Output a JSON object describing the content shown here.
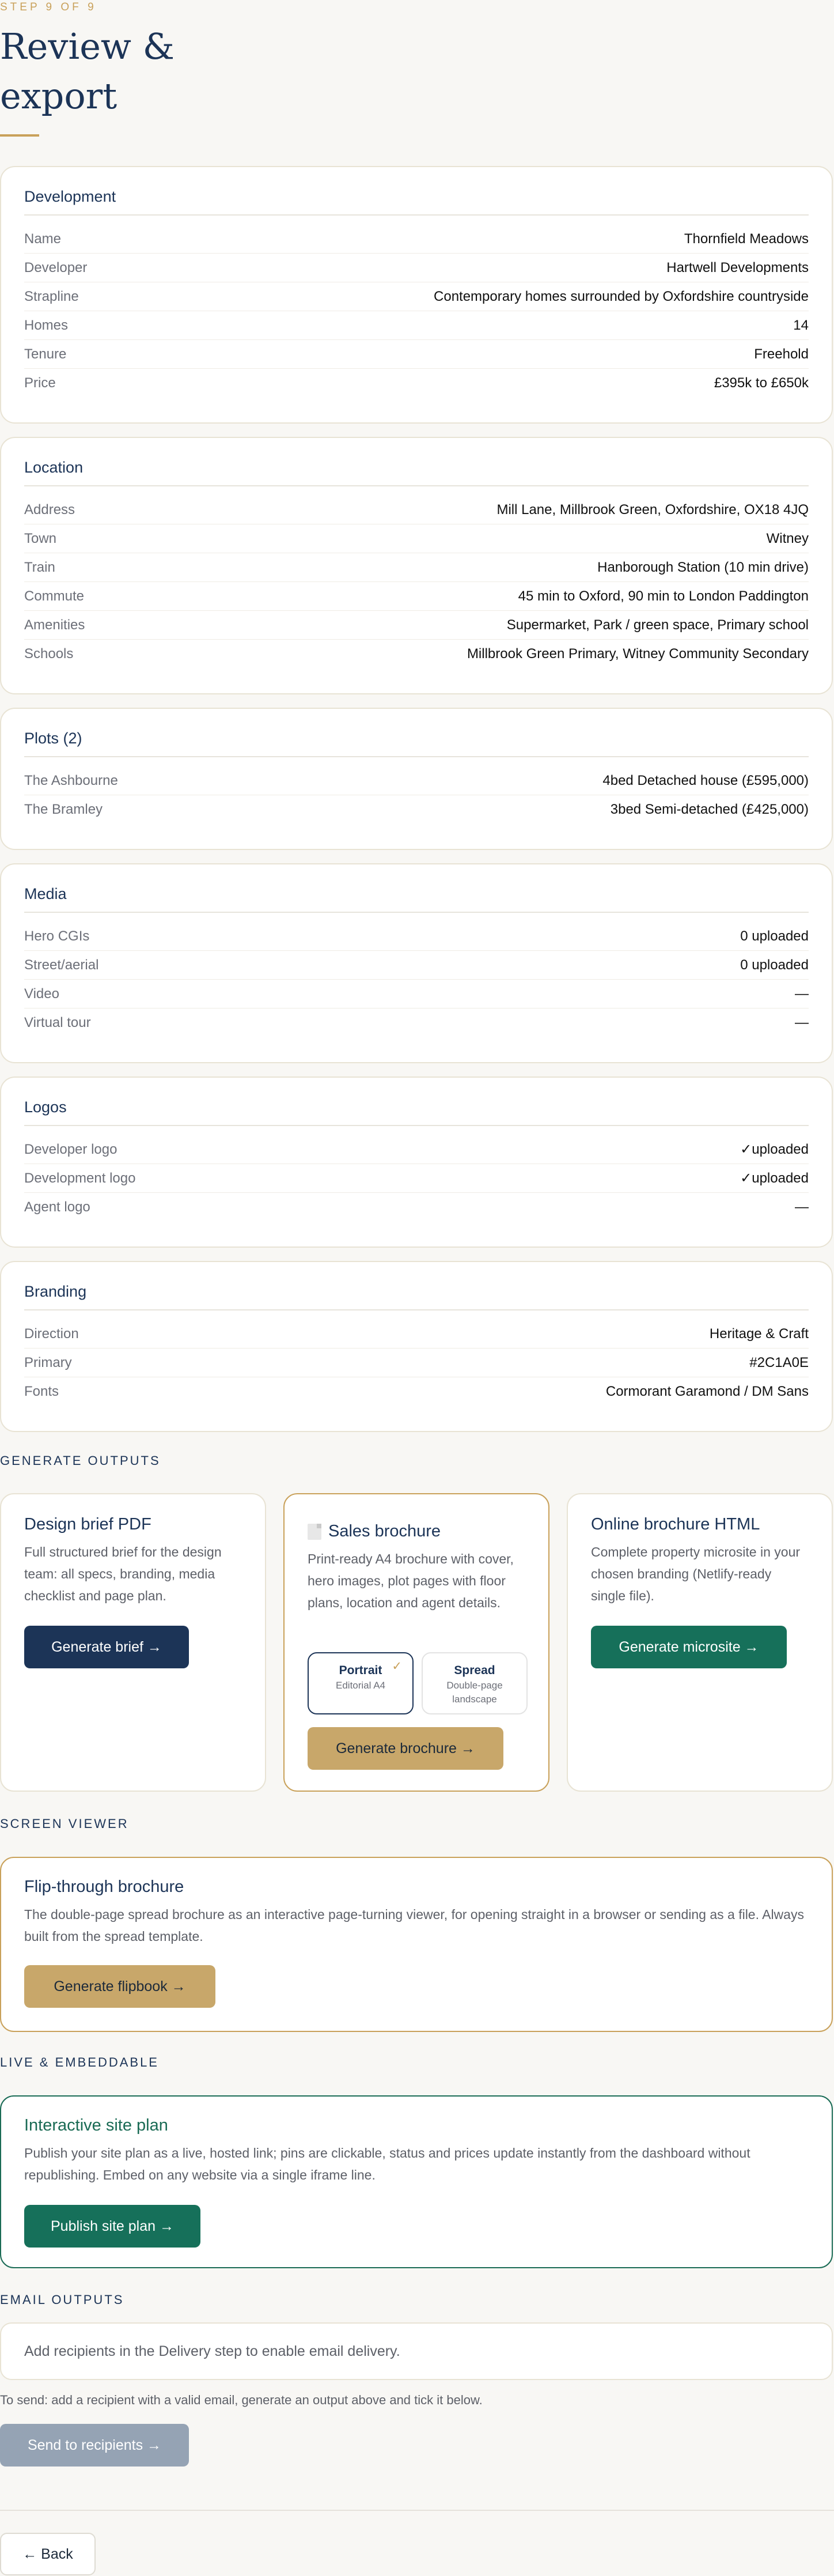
{
  "header": {
    "step_label": "STEP 9 OF 9",
    "title": "Review & export"
  },
  "development": {
    "title": "Development",
    "rows": [
      {
        "key": "Name",
        "value": "Thornfield Meadows"
      },
      {
        "key": "Developer",
        "value": "Hartwell Developments"
      },
      {
        "key": "Strapline",
        "value": "Contemporary homes surrounded by Oxfordshire countryside"
      },
      {
        "key": "Homes",
        "value": "14"
      },
      {
        "key": "Tenure",
        "value": "Freehold"
      },
      {
        "key": "Price",
        "value": "£395k to £650k"
      }
    ]
  },
  "location": {
    "title": "Location",
    "rows": [
      {
        "key": "Address",
        "value": "Mill Lane, Millbrook Green, Oxfordshire, OX18 4JQ"
      },
      {
        "key": "Town",
        "value": "Witney"
      },
      {
        "key": "Train",
        "value": "Hanborough Station (10 min drive)"
      },
      {
        "key": "Commute",
        "value": "45 min to Oxford, 90 min to London Paddington"
      },
      {
        "key": "Amenities",
        "value": "Supermarket, Park / green space, Primary school"
      },
      {
        "key": "Schools",
        "value": "Millbrook Green Primary, Witney Community Secondary"
      }
    ]
  },
  "plots": {
    "title": "Plots (2)",
    "rows": [
      {
        "key": "The Ashbourne",
        "value": "4bed Detached house (£595,000)"
      },
      {
        "key": "The Bramley",
        "value": "3bed Semi-detached (£425,000)"
      }
    ]
  },
  "media": {
    "title": "Media",
    "rows": [
      {
        "key": "Hero CGIs",
        "value": "0 uploaded"
      },
      {
        "key": "Street/aerial",
        "value": "0 uploaded"
      },
      {
        "key": "Video",
        "value": "—"
      },
      {
        "key": "Virtual tour",
        "value": "—"
      }
    ]
  },
  "logos": {
    "title": "Logos",
    "rows": [
      {
        "key": "Developer logo",
        "value": "✓uploaded"
      },
      {
        "key": "Development logo",
        "value": "✓uploaded"
      },
      {
        "key": "Agent logo",
        "value": "—"
      }
    ]
  },
  "branding": {
    "title": "Branding",
    "rows": [
      {
        "key": "Direction",
        "value": "Heritage & Craft"
      },
      {
        "key": "Primary",
        "value": "#2C1A0E"
      },
      {
        "key": "Fonts",
        "value": "Cormorant Garamond / DM Sans"
      }
    ]
  },
  "generate_outputs": {
    "heading": "GENERATE OUTPUTS",
    "design_brief": {
      "title": "Design brief PDF",
      "description": "Full structured brief for the design team: all specs, branding, media checklist and page plan.",
      "button": "Generate brief →"
    },
    "sales_brochure": {
      "icon": "document-icon",
      "title": "Sales brochure",
      "description": "Print-ready A4 brochure with cover, hero images, plot pages with floor plans, location and agent details.",
      "options": [
        {
          "name": "Portrait",
          "sub": "Editorial A4",
          "selected": true
        },
        {
          "name": "Spread",
          "sub": "Double-page landscape",
          "selected": false
        }
      ],
      "selected_mark": "✓",
      "button": "Generate brochure →"
    },
    "online_brochure": {
      "title": "Online brochure HTML",
      "description": "Complete property microsite in your chosen branding (Netlify-ready single file).",
      "button": "Generate microsite →"
    }
  },
  "screen_viewer": {
    "heading": "SCREEN VIEWER",
    "title": "Flip-through brochure",
    "description": "The double-page spread brochure as an interactive page-turning viewer, for opening straight in a browser or sending as a file. Always built from the spread template.",
    "button": "Generate flipbook →"
  },
  "live_embeddable": {
    "heading": "LIVE & EMBEDDABLE",
    "title": "Interactive site plan",
    "description": "Publish your site plan as a live, hosted link; pins are clickable, status and prices update instantly from the dashboard without republishing. Embed on any website via a single iframe line.",
    "button": "Publish site plan →"
  },
  "email_outputs": {
    "heading": "EMAIL OUTPUTS",
    "notice": "Add recipients in the Delivery step to enable email delivery.",
    "hint": "To send: add a recipient with a valid email, generate an output above and tick it below.",
    "button": "Send to recipients →"
  },
  "footer": {
    "back_button": "← Back"
  },
  "colors": {
    "navy": "#1c3457",
    "gold": "#c9a15a",
    "green": "#16705a",
    "disabled": "#95a3b4"
  }
}
